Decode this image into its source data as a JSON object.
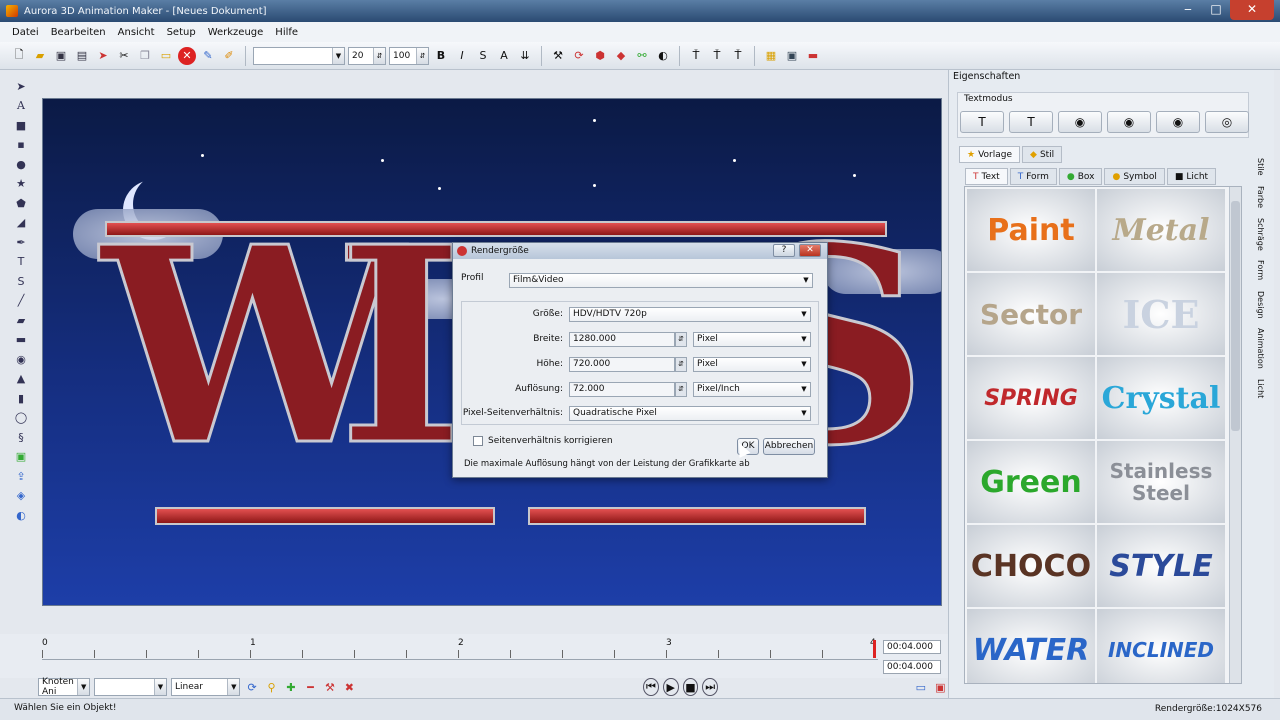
{
  "window": {
    "title": "Aurora 3D Animation Maker - [Neues Dokument]"
  },
  "menu": [
    "Datei",
    "Bearbeiten",
    "Ansicht",
    "Setup",
    "Werkzeuge",
    "Hilfe"
  ],
  "toolbar": {
    "font_size": "20",
    "zoom": "100",
    "bold": "B",
    "italic": "I",
    "strike": "S",
    "text_a": "A"
  },
  "timeline": {
    "ticks": [
      "0",
      "1",
      "2",
      "3",
      "4"
    ],
    "time_top": "00:04.000",
    "time_bottom": "00:04.000",
    "node_select": "Knoten Ani",
    "empty_select": "",
    "interp_select": "Linear"
  },
  "status": {
    "left": "Wählen Sie ein Objekt!",
    "right": "Rendergröße:1024X576"
  },
  "properties": {
    "title": "Eigenschaften",
    "text_mode_label": "Textmodus",
    "tabs_top": [
      "Vorlage",
      "Stil"
    ],
    "tabs_sub": [
      "Text",
      "Form",
      "Box",
      "Symbol",
      "Licht"
    ],
    "side_tabs": [
      "Stile",
      "Farbe",
      "Schräge",
      "Form",
      "Design",
      "Animation",
      "Licht"
    ],
    "gallery": [
      "Paint",
      "Metal",
      "Sector",
      "ICE",
      "SPRING",
      "Crystal",
      "Green",
      "Stainless Steel",
      "CHOCO",
      "STYLE",
      "WATER",
      "INCLINED"
    ]
  },
  "dialog": {
    "title": "Rendergröße",
    "help": "?",
    "profile_label": "Profil",
    "profile_value": "Film&Video",
    "size_label": "Größe:",
    "size_value": "HDV/HDTV 720p",
    "width_label": "Breite:",
    "width_value": "1280.000",
    "width_unit": "Pixel",
    "height_label": "Höhe:",
    "height_value": "720.000",
    "height_unit": "Pixel",
    "resolution_label": "Auflösung:",
    "resolution_value": "72.000",
    "resolution_unit": "Pixel/Inch",
    "aspect_label": "Pixel-Seitenverhältnis:",
    "aspect_value": "Quadratische Pixel",
    "keep_ratio_label": "Seitenverhältnis korrigieren",
    "ok": "OK",
    "cancel": "Abbrechen",
    "note": "Die maximale Auflösung hängt von der Leistung der Grafikkarte ab"
  },
  "colors": {
    "accent": "#c6402e",
    "titlebar": "#2a4a72"
  }
}
